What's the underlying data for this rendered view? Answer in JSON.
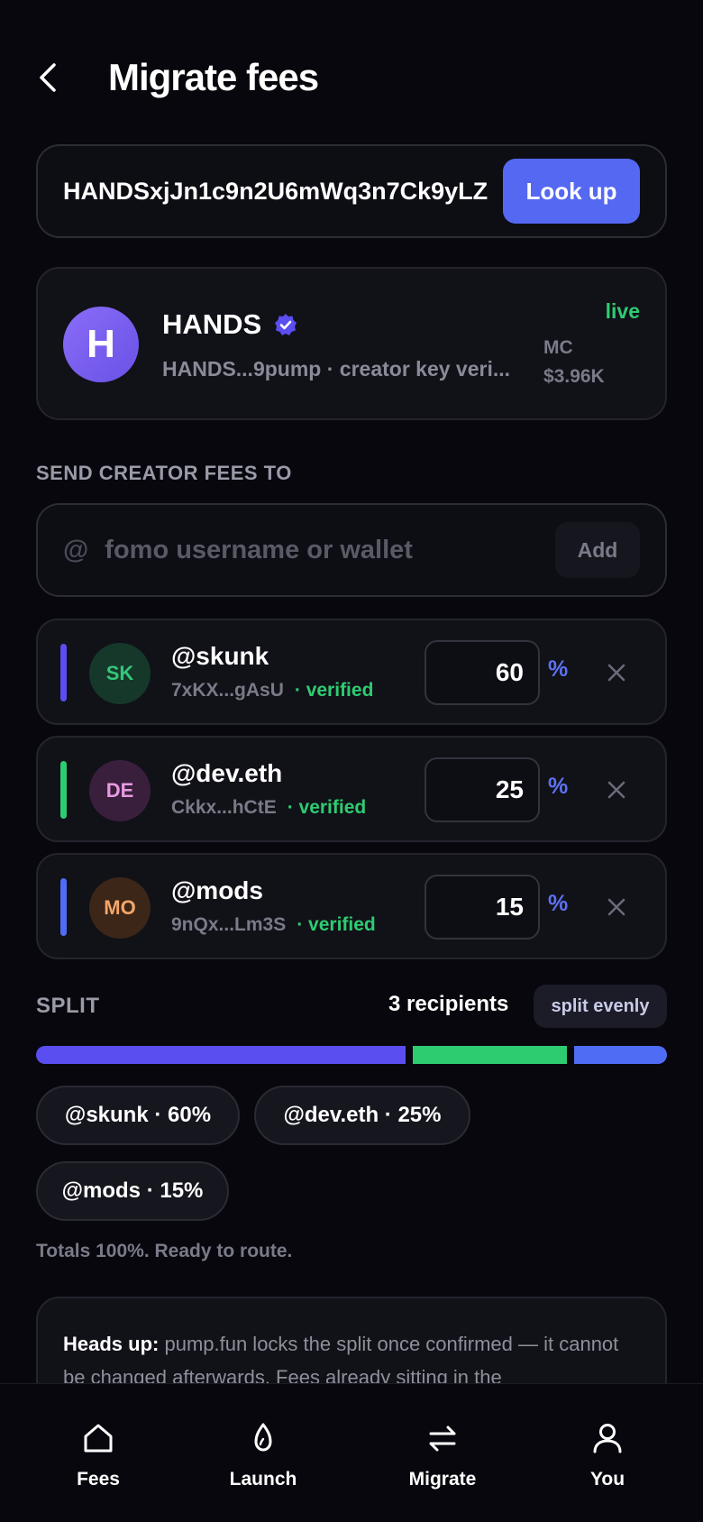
{
  "header": {
    "title": "Migrate fees"
  },
  "lookup": {
    "mint_value": "HANDSxjJn1c9n2U6mWq3n7Ck9yLZ",
    "button_label": "Look up"
  },
  "token": {
    "avatar_letter": "H",
    "name": "HANDS",
    "subtitle": "HANDS...9pump · creator key veri...",
    "status": "live",
    "mc_label": "MC",
    "mc_value": "$3.96K"
  },
  "recipients_section": {
    "label": "SEND CREATOR FEES TO",
    "at_symbol": "@",
    "input_placeholder": "fomo username or wallet",
    "add_label": "Add",
    "percent_symbol": "%",
    "verified_label": "· verified",
    "items": [
      {
        "initials": "SK",
        "handle": "@skunk",
        "wallet": "7xKX...gAsU",
        "percent": "60",
        "accent": "#5b4ef0",
        "avatar_bg": "#15382a",
        "avatar_fg": "#35c67a"
      },
      {
        "initials": "DE",
        "handle": "@dev.eth",
        "wallet": "Ckkx...hCtE",
        "percent": "25",
        "accent": "#2ecc71",
        "avatar_bg": "#3a1f3c",
        "avatar_fg": "#e79ae2"
      },
      {
        "initials": "MO",
        "handle": "@mods",
        "wallet": "9nQx...Lm3S",
        "percent": "15",
        "accent": "#4f6cf5",
        "avatar_bg": "#3b2617",
        "avatar_fg": "#f4a66a"
      }
    ]
  },
  "split": {
    "label": "SPLIT",
    "count_text": "3 recipients",
    "split_evenly_label": "split evenly",
    "segments": [
      {
        "name": "@skunk",
        "percent": 60,
        "color": "#5b4ef0"
      },
      {
        "name": "@dev.eth",
        "percent": 25,
        "color": "#2ecc71"
      },
      {
        "name": "@mods",
        "percent": 15,
        "color": "#4f6cf5"
      }
    ],
    "chips": [
      "@skunk · 60%",
      "@dev.eth · 25%",
      "@mods · 15%"
    ],
    "totals_text": "Totals 100%. Ready to route."
  },
  "notice": {
    "title": "Heads up:",
    "body": " pump.fun locks the split once confirmed — it cannot be changed afterwards. Fees already sitting in the"
  },
  "tabbar": {
    "tabs": [
      {
        "label": "Fees",
        "icon": "home-icon"
      },
      {
        "label": "Launch",
        "icon": "flame-icon"
      },
      {
        "label": "Migrate",
        "icon": "swap-arrows-icon"
      },
      {
        "label": "You",
        "icon": "user-icon"
      }
    ]
  },
  "colors": {
    "accent": "#5568f2",
    "live": "#2ecc71",
    "background": "#07070d"
  }
}
